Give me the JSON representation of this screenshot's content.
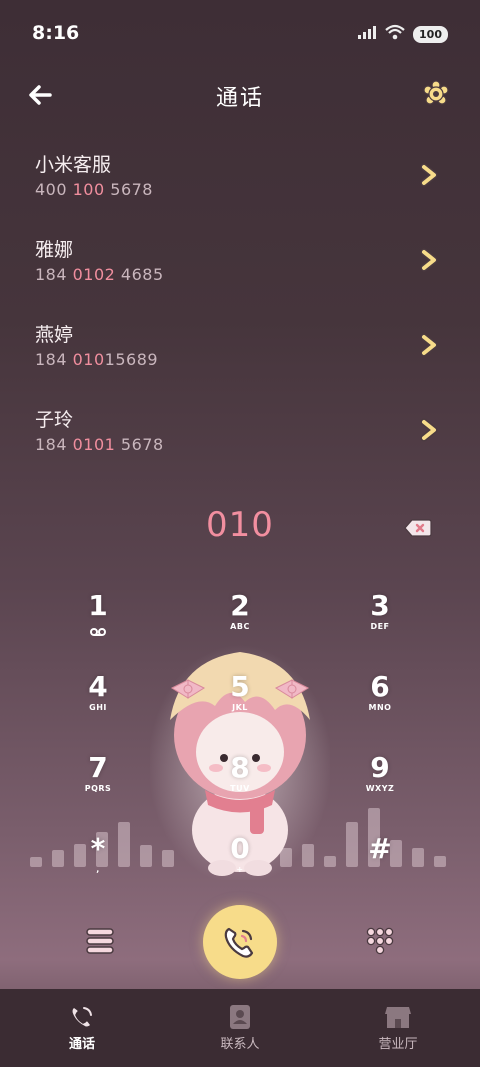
{
  "status_bar": {
    "time": "8:16",
    "battery": "100"
  },
  "header": {
    "title": "通话"
  },
  "contacts": [
    {
      "name": "小米客服",
      "num_pre": "400 ",
      "num_hl": "100",
      "num_post": " 5678"
    },
    {
      "name": "雅娜",
      "num_pre": "184 ",
      "num_hl": "0102",
      "num_post": " 4685"
    },
    {
      "name": "燕婷",
      "num_pre": "184 ",
      "num_hl": "010",
      "num_post": "15689"
    },
    {
      "name": "子玲",
      "num_pre": "184 ",
      "num_hl": "0101",
      "num_post": " 5678"
    }
  ],
  "dialed": "010",
  "keypad": [
    {
      "digit": "1",
      "letters": ""
    },
    {
      "digit": "2",
      "letters": "ABC"
    },
    {
      "digit": "3",
      "letters": "DEF"
    },
    {
      "digit": "4",
      "letters": "GHI"
    },
    {
      "digit": "5",
      "letters": "JKL"
    },
    {
      "digit": "6",
      "letters": "MNO"
    },
    {
      "digit": "7",
      "letters": "PQRS"
    },
    {
      "digit": "8",
      "letters": "TUV"
    },
    {
      "digit": "9",
      "letters": "WXYZ"
    },
    {
      "digit": "*",
      "letters": ","
    },
    {
      "digit": "0",
      "letters": "+"
    },
    {
      "digit": "#",
      "letters": ""
    }
  ],
  "tabs": [
    {
      "label": "通话"
    },
    {
      "label": "联系人"
    },
    {
      "label": "营业厅"
    }
  ],
  "colors": {
    "accent": "#f7dc8a",
    "highlight": "#f08e9e"
  }
}
